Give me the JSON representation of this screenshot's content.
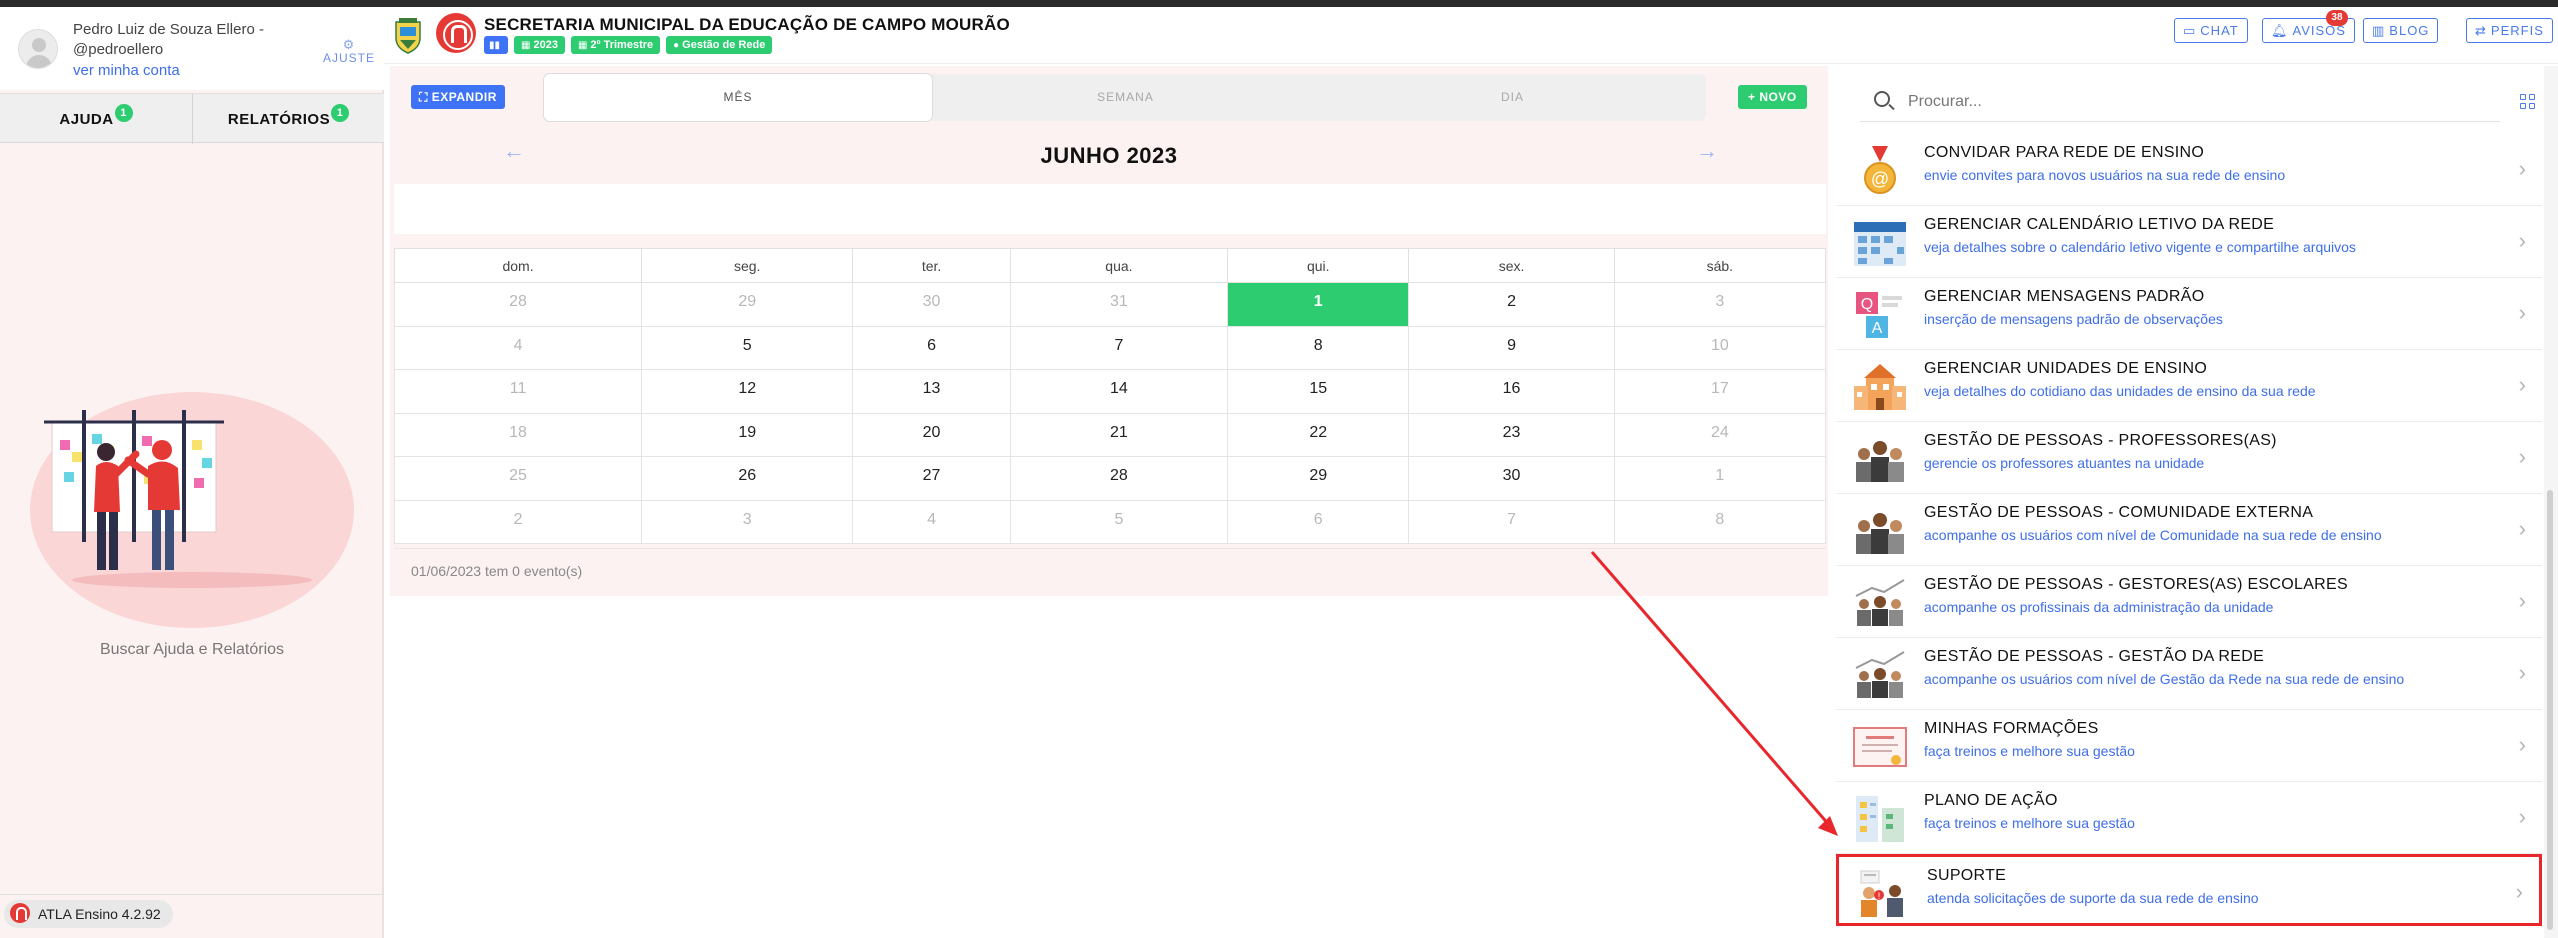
{
  "user": {
    "name_line1": "Pedro Luiz de Souza Ellero -",
    "name_line2": "@pedroellero",
    "account_link": "ver minha conta",
    "settings_label": "AJUSTE"
  },
  "sidebar": {
    "tabs": [
      {
        "label": "AJUDA",
        "count": "1"
      },
      {
        "label": "RELATÓRIOS",
        "count": "1"
      }
    ],
    "help_caption": "Buscar Ajuda e Relatórios",
    "version": "ATLA Ensino 4.2.92"
  },
  "header": {
    "org_title": "SECRETARIA MUNICIPAL DA EDUCAÇÃO DE CAMPO MOURÃO",
    "chips": {
      "year": "2023",
      "term": "2º Trimestre",
      "role": "Gestão de Rede"
    },
    "buttons": {
      "chat": "CHAT",
      "avisos": "AVISOS",
      "avisos_count": "38",
      "blog": "BLOG",
      "perfis": "PERFIS"
    }
  },
  "calendar": {
    "expand_label": "EXPANDIR",
    "new_label": "NOVO",
    "views": [
      "MÊS",
      "SEMANA",
      "DIA"
    ],
    "active_view": "MÊS",
    "month_title": "JUNHO 2023",
    "weekdays": [
      "dom.",
      "seg.",
      "ter.",
      "qua.",
      "qui.",
      "sex.",
      "sáb."
    ],
    "weeks": [
      [
        "28",
        "29",
        "30",
        "31",
        "1",
        "2",
        "3"
      ],
      [
        "4",
        "5",
        "6",
        "7",
        "8",
        "9",
        "10"
      ],
      [
        "11",
        "12",
        "13",
        "14",
        "15",
        "16",
        "17"
      ],
      [
        "18",
        "19",
        "20",
        "21",
        "22",
        "23",
        "24"
      ],
      [
        "25",
        "26",
        "27",
        "28",
        "29",
        "30",
        "1"
      ],
      [
        "2",
        "3",
        "4",
        "5",
        "6",
        "7",
        "8"
      ]
    ],
    "today": "1",
    "footer_text": "01/06/2023 tem 0 evento(s)"
  },
  "search": {
    "placeholder": "Procurar..."
  },
  "menu_items": [
    {
      "title": "CONVIDAR PARA REDE DE ENSINO",
      "subtitle": "envie convites para novos usuários na sua rede de ensino",
      "icon": "medal-icon"
    },
    {
      "title": "GERENCIAR CALENDÁRIO LETIVO DA REDE",
      "subtitle": "veja detalhes sobre o calendário letivo vigente e compartilhe arquivos",
      "icon": "calendar-icon"
    },
    {
      "title": "GERENCIAR MENSAGENS PADRÃO",
      "subtitle": "inserção de mensagens padrão de observações",
      "icon": "qa-icon"
    },
    {
      "title": "GERENCIAR UNIDADES DE ENSINO",
      "subtitle": "veja detalhes do cotidiano das unidades de ensino da sua rede",
      "icon": "school-building-icon"
    },
    {
      "title": "GESTÃO DE PESSOAS - PROFESSORES(AS)",
      "subtitle": "gerencie os professores atuantes na unidade",
      "icon": "people-group-icon"
    },
    {
      "title": "GESTÃO DE PESSOAS - COMUNIDADE EXTERNA",
      "subtitle": "acompanhe os usuários com nível de Comunidade na sua rede de ensino",
      "icon": "people-group-icon"
    },
    {
      "title": "GESTÃO DE PESSOAS - GESTORES(AS) ESCOLARES",
      "subtitle": "acompanhe os profissinais da administração da unidade",
      "icon": "people-growth-icon"
    },
    {
      "title": "GESTÃO DE PESSOAS - GESTÃO DA REDE",
      "subtitle": "acompanhe os usuários com nível de Gestão da Rede na sua rede de ensino",
      "icon": "people-growth-icon"
    },
    {
      "title": "MINHAS FORMAÇÕES",
      "subtitle": "faça treinos e melhore sua gestão",
      "icon": "certificate-icon"
    },
    {
      "title": "PLANO DE AÇÃO",
      "subtitle": "faça treinos e melhore sua gestão",
      "icon": "action-plan-icon"
    },
    {
      "title": "SUPORTE",
      "subtitle": "atenda solicitações de suporte da sua rede de ensino",
      "icon": "support-icon"
    }
  ],
  "colors": {
    "accent_blue": "#3f73f5",
    "green": "#2ecc71",
    "brand_red": "#e53935",
    "highlight_red": "#e8262b",
    "panel_pink": "#fdf2f2"
  }
}
